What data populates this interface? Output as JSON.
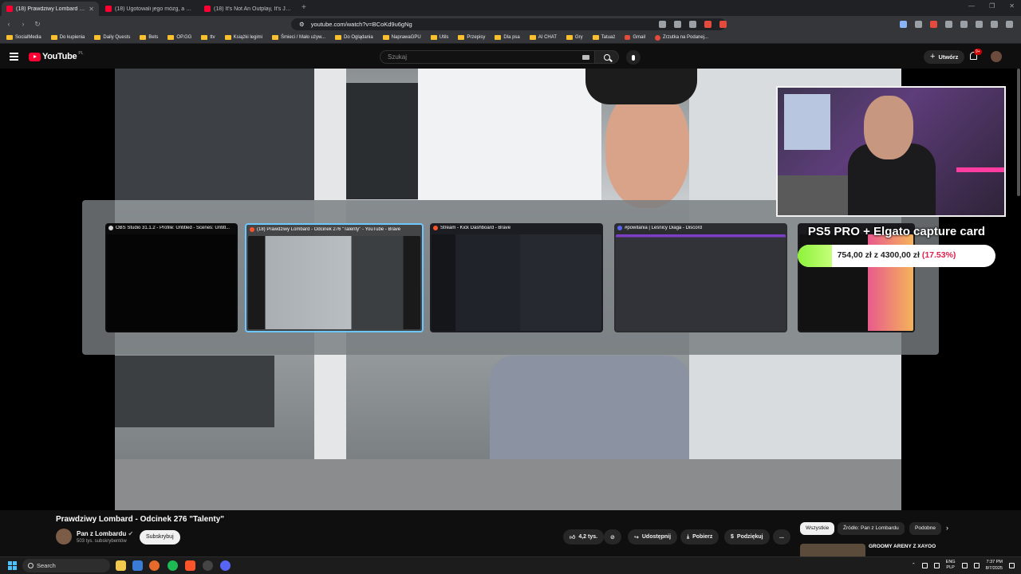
{
  "browser": {
    "tabs": [
      {
        "label": "(18) Prawdziwy Lombard - Od",
        "active": true
      },
      {
        "label": "(18) Ugotowali jego mózg, a go złoc",
        "active": false
      },
      {
        "label": "(18) It's Not An Outplay, It's Just Wa",
        "active": false
      }
    ],
    "url": "youtube.com/watch?v=BCoKd9u6gNg",
    "bookmarks": [
      "SocialMedia",
      "Do kupienia",
      "Daily Quests",
      "Bets",
      "OP.GG",
      "ttv",
      "Książki legimi",
      "Śmieci / Mało używ...",
      "Do Oglądania",
      "NaprawaGPU",
      "Utils",
      "Przepisy",
      "Dla psa",
      "AI CHAT",
      "Gry",
      "Tatuaż",
      "Gmail",
      "Zrzutka na Podanej..."
    ]
  },
  "youtube": {
    "logo_text": "YouTube",
    "country_code": "PL",
    "search_placeholder": "Szukaj",
    "create_label": "Utwórz",
    "notification_badge": "9+"
  },
  "switcher": {
    "windows": [
      {
        "title": "OBS Studio 31.1.2 - Profile: Untitled - Scenes: Untitl...",
        "selected": false,
        "icon_color": "#d0d0d0"
      },
      {
        "title": "(18) Prawdziwy Lombard - Odcinek 276 \"Talenty\" - YouTube - Brave",
        "selected": true,
        "icon_color": "#fb542b"
      },
      {
        "title": "Stream - Kick Dashboard - Brave",
        "selected": false,
        "icon_color": "#fb542b"
      },
      {
        "title": "#powitania | Leśnicy Diaga - Discord",
        "selected": false,
        "icon_color": "#5865f2"
      }
    ]
  },
  "overlay": {
    "goal_title": "PS5 PRO + Elgato capture card",
    "goal_current": "754,00 zł",
    "goal_sep": "z",
    "goal_target": "4300,00 zł",
    "goal_percent": "(17.53%)",
    "goal_fraction": 0.1753
  },
  "video": {
    "title": "Prawdziwy Lombard - Odcinek 276 \"Talenty\"",
    "channel": "Pan z Lombardu",
    "subscribers": "503 tys. subskrybentów",
    "subscribe_label": "Subskrybuj",
    "likes": "4,2 tys.",
    "share_label": "Udostępnij",
    "download_label": "Pobierz",
    "thanks_label": "Podziękuj",
    "more_label": "..."
  },
  "recommendations": {
    "chips": [
      "Wszystkie",
      "Źródło: Pan z Lombardu",
      "Podobne"
    ],
    "first_title": "GROOMY ARENY Z XAYOO"
  },
  "taskbar": {
    "search_label": "Search",
    "lang_top": "ENG",
    "lang_bottom": "PLP",
    "time": "7:37 PM",
    "date": "8/7/2025"
  }
}
